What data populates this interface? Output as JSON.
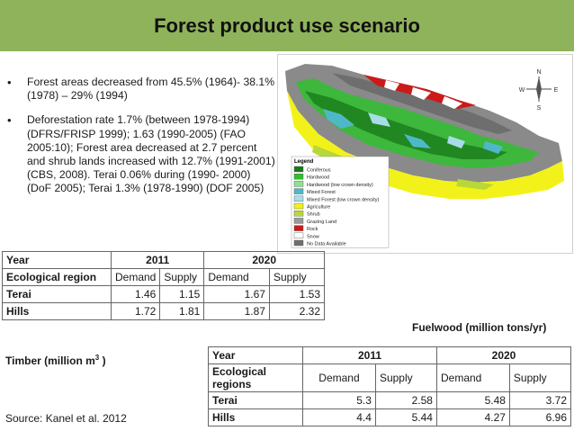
{
  "title": "Forest product use scenario",
  "bullets": [
    "Forest areas decreased from 45.5% (1964)- 38.1% (1978) – 29% (1994)",
    "Deforestation rate 1.7% (between 1978-1994)(DFRS/FRISP 1999); 1.63 (1990-2005) (FAO 2005:10); Forest area decreased at 2.7 percent and shrub lands increased with 12.7% (1991-2001) (CBS, 2008). Terai 0.06% during (1990- 2000) (DoF 2005); Terai 1.3% (1978-1990) (DOF 2005)"
  ],
  "map": {
    "legend_title": "Legend",
    "legend_items": [
      {
        "label": "Coniferous",
        "color": "#1a7a1a"
      },
      {
        "label": "Hardwood",
        "color": "#2fbf2f"
      },
      {
        "label": "Hardwood (low crown density)",
        "color": "#8fe08f"
      },
      {
        "label": "Mixed Forest",
        "color": "#4fb8c8"
      },
      {
        "label": "Mixed Forest (low crown density)",
        "color": "#a8dce8"
      },
      {
        "label": "Agriculture",
        "color": "#f2f21a"
      },
      {
        "label": "Shrub",
        "color": "#b8d838"
      },
      {
        "label": "Grazing Land",
        "color": "#9a9a9a"
      },
      {
        "label": "Rock",
        "color": "#cc1a1a"
      },
      {
        "label": "Snow",
        "color": "#ffffff"
      },
      {
        "label": "No Data Available",
        "color": "#6e6e6e"
      }
    ],
    "compass": {
      "n": "N",
      "s": "S",
      "e": "E",
      "w": "W"
    }
  },
  "timber_table": {
    "header": {
      "year": "Year",
      "y1": "2011",
      "y2": "2020"
    },
    "subheader": {
      "region": "Ecological region",
      "d1": "Demand",
      "s1": "Supply",
      "d2": "Demand",
      "s2": "Supply"
    },
    "rows": [
      {
        "region": "Terai",
        "d1": "1.46",
        "s1": "1.15",
        "d2": "1.67",
        "s2": "1.53"
      },
      {
        "region": "Hills",
        "d1": "1.72",
        "s1": "1.81",
        "d2": "1.87",
        "s2": "2.32"
      }
    ]
  },
  "fuelwood_label": "Fuelwood (million tons/yr)",
  "timber_label": "Timber (million m",
  "timber_label_sup": "3",
  "timber_label_end": ")",
  "fuelwood_table": {
    "header": {
      "year": "Year",
      "y1": "2011",
      "y2": "2020"
    },
    "subheader": {
      "region": "Ecological regions",
      "d1": "Demand",
      "s1": "Supply",
      "d2": "Demand",
      "s2": "Supply"
    },
    "rows": [
      {
        "region": "Terai",
        "d1": "5.3",
        "s1": "2.58",
        "d2": "5.48",
        "s2": "3.72"
      },
      {
        "region": "Hills",
        "d1": "4.4",
        "s1": "5.44",
        "d2": "4.27",
        "s2": "6.96"
      }
    ]
  },
  "source": "Source: Kanel et al. 2012"
}
